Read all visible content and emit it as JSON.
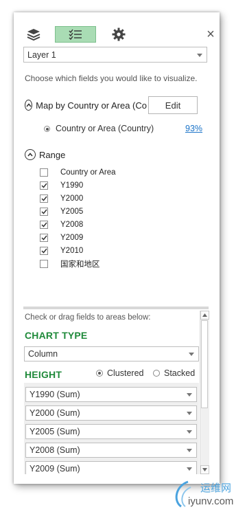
{
  "toolbar": {
    "icons": [
      "layers-icon",
      "fields-list-icon",
      "gear-icon",
      "close-icon"
    ],
    "active_tab_color": "#a9dcb4",
    "close_label": "×"
  },
  "layer_select": {
    "value": "Layer 1"
  },
  "instructions": "Choose which fields you would like to visualize.",
  "map_section": {
    "title": "Map by Country or Area (Co",
    "edit_label": "Edit",
    "geo_field": "Country or Area (Country)",
    "confidence": "93%"
  },
  "range_section": {
    "title": "Range",
    "fields": [
      {
        "label": "Country or Area",
        "checked": false
      },
      {
        "label": "Y1990",
        "checked": true
      },
      {
        "label": "Y2000",
        "checked": true
      },
      {
        "label": "Y2005",
        "checked": true
      },
      {
        "label": "Y2008",
        "checked": true
      },
      {
        "label": "Y2009",
        "checked": true
      },
      {
        "label": "Y2010",
        "checked": true
      },
      {
        "label": "国家和地区",
        "checked": false
      }
    ]
  },
  "lower": {
    "instructions": "Check or drag fields to areas below:",
    "chart_type_heading": "CHART TYPE",
    "chart_type_value": "Column",
    "height_heading": "HEIGHT",
    "height_options": [
      {
        "label": "Clustered",
        "selected": true
      },
      {
        "label": "Stacked",
        "selected": false
      }
    ],
    "height_values": [
      "Y1990 (Sum)",
      "Y2000 (Sum)",
      "Y2005 (Sum)",
      "Y2008 (Sum)",
      "Y2009 (Sum)"
    ],
    "accent_color": "#1f8a3a"
  },
  "watermark": {
    "brand": "运维网",
    "url": "iyunv.com"
  }
}
